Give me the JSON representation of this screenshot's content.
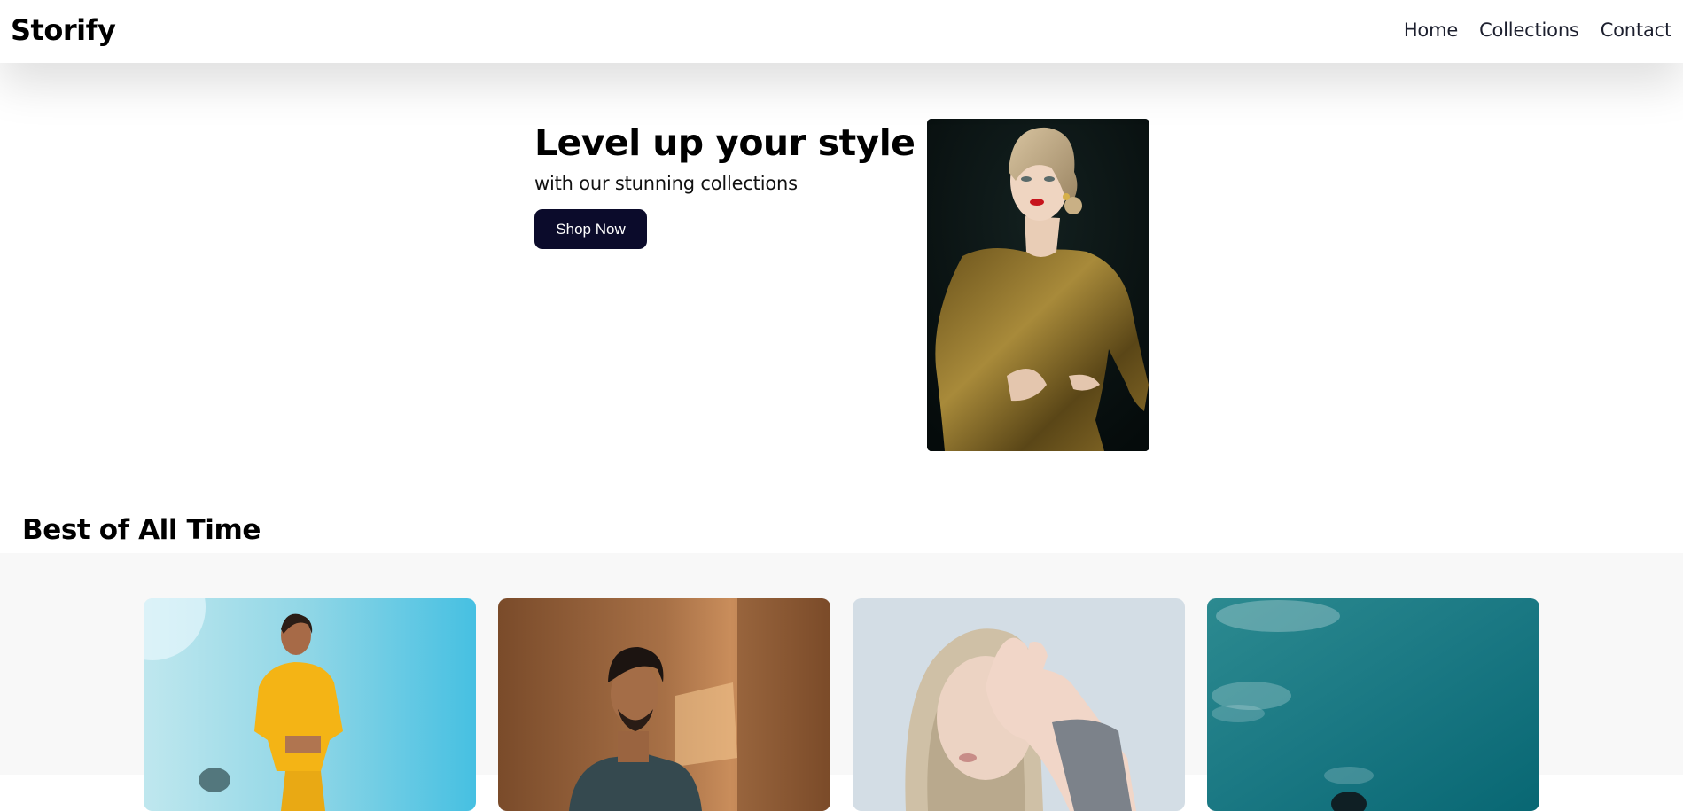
{
  "navbar": {
    "brand": "Storify",
    "links": [
      "Home",
      "Collections",
      "Contact"
    ]
  },
  "hero": {
    "title": "Level up your style",
    "subtitle": "with our stunning collections",
    "cta_label": "Shop Now",
    "image": "woman-gold-sequin-dress-photo"
  },
  "best_of_all_time": {
    "title": "Best of All Time",
    "cards": [
      {
        "image": "woman-yellow-hoodie-photo"
      },
      {
        "image": "man-denim-shirt-photo"
      },
      {
        "image": "woman-hand-on-face-photo"
      },
      {
        "image": "teal-sky-portrait-photo"
      }
    ]
  },
  "colors": {
    "cta_background": "#0b0b2b",
    "gallery_background": "#f8f8f8",
    "nav_text": "#1c1f2e"
  }
}
